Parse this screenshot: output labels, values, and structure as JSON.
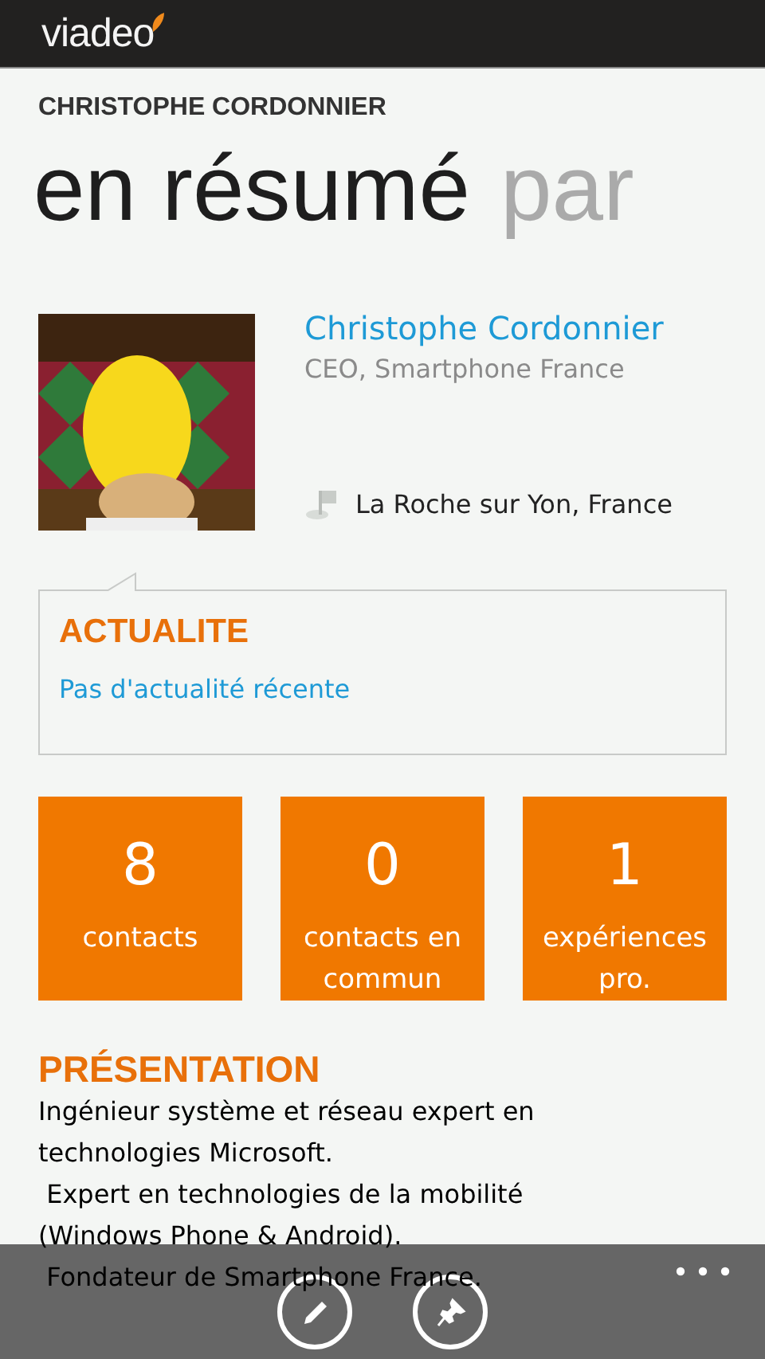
{
  "header": {
    "logo": "viadeo"
  },
  "profile_title": "CHRISTOPHE CORDONNIER",
  "pivots": [
    {
      "label": "en résumé",
      "selected": true
    },
    {
      "label": "par",
      "selected": false
    }
  ],
  "profile": {
    "name": "Christophe Cordonnier",
    "position": "CEO, Smartphone France",
    "location": "La Roche sur Yon, France"
  },
  "news": {
    "title": "ACTUALITE",
    "text": "Pas d'actualité récente"
  },
  "tiles": [
    {
      "count": "8",
      "label": "contacts"
    },
    {
      "count": "0",
      "label": "contacts en commun"
    },
    {
      "count": "1",
      "label": "expériences pro."
    }
  ],
  "presentation": {
    "title": "PRÉSENTATION",
    "paragraphs": [
      "Ingénieur système et réseau expert en technologies Microsoft.",
      " Expert en technologies de la mobilité (Windows Phone & Android).",
      " Fondateur de Smartphone France."
    ]
  },
  "app_bar": {
    "buttons": [
      {
        "kind": "edit"
      },
      {
        "kind": "pin"
      }
    ],
    "more": true
  }
}
